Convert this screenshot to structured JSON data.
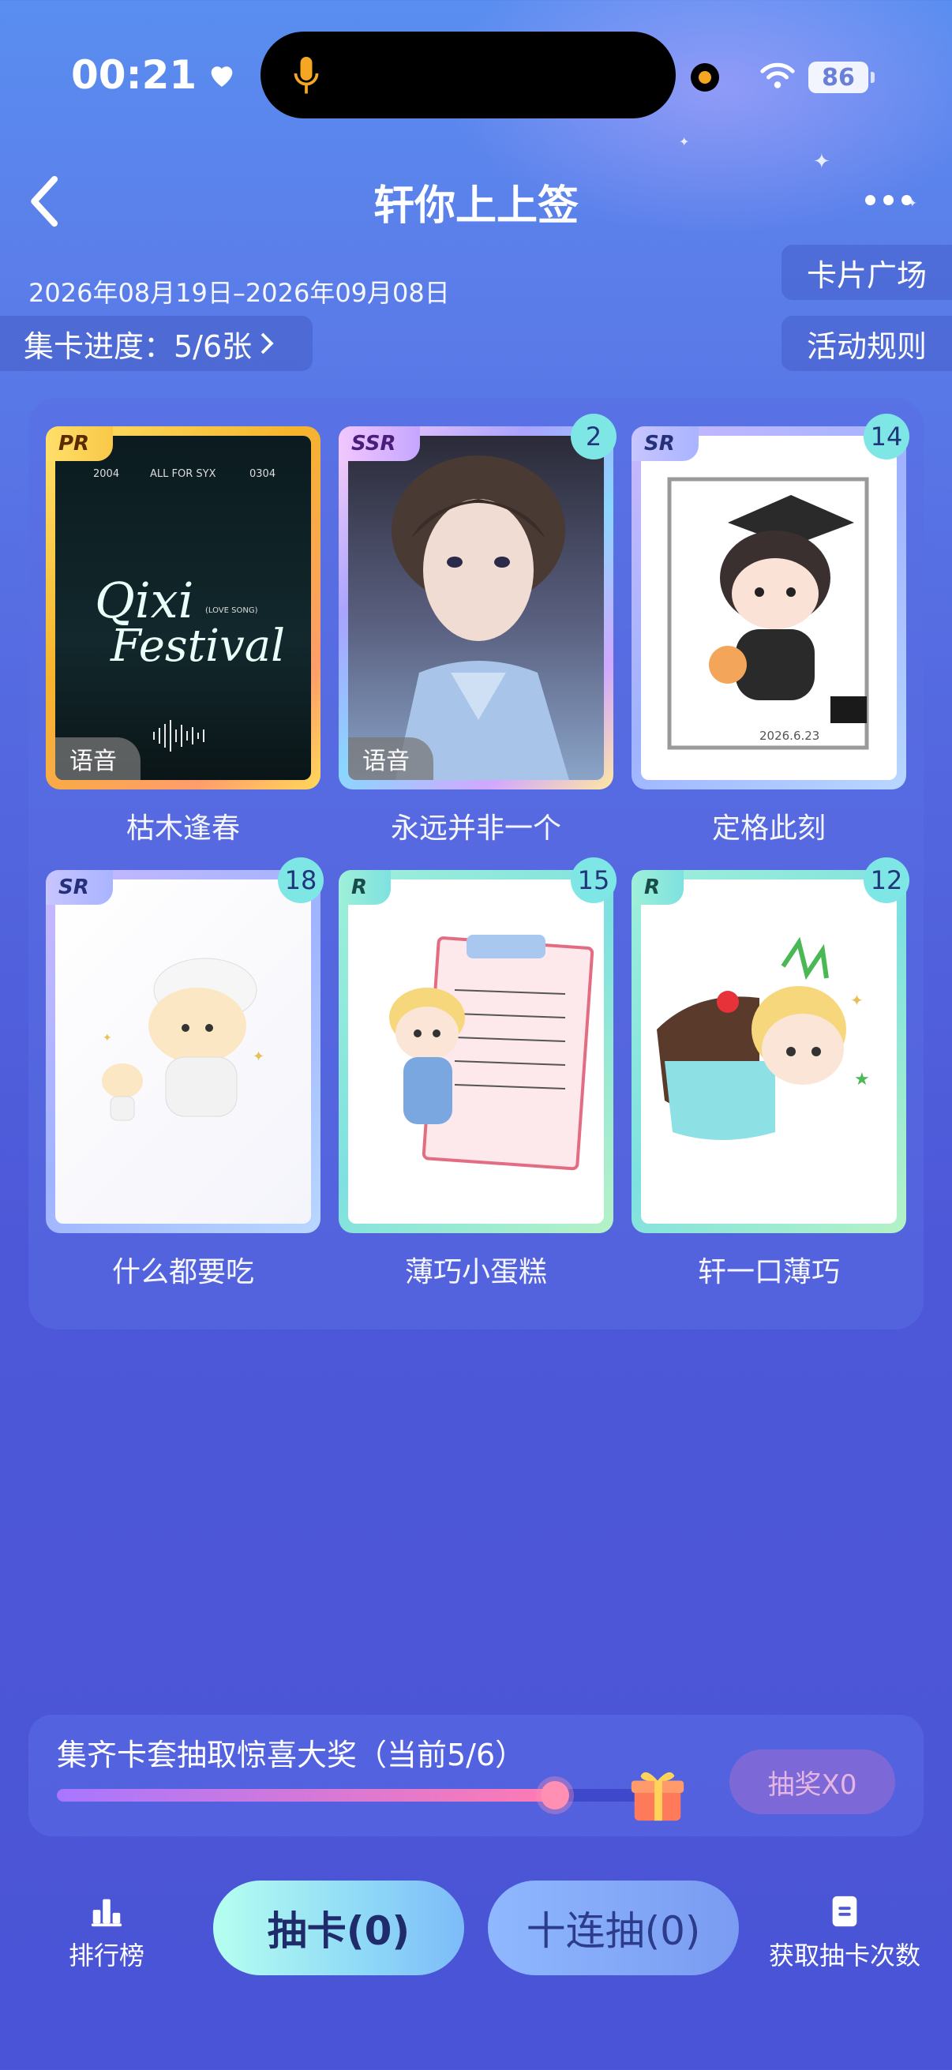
{
  "status_bar": {
    "time": "00:21",
    "battery": "86"
  },
  "header": {
    "title": "轩你上上签"
  },
  "event": {
    "date_range": "2026年08月19日–2026年09月08日",
    "progress_label": "集卡进度：5/6张",
    "card_plaza_label": "卡片广场",
    "rules_label": "活动规则"
  },
  "cards": [
    {
      "name": "枯木逢春",
      "rarity": "PR",
      "count": "",
      "voice": "语音",
      "art_text": [
        "2004",
        "ALL FOR SYX",
        "0304",
        "Qixi",
        "(LOVE SONG)",
        "Festival"
      ]
    },
    {
      "name": "永远并非一个",
      "rarity": "SSR",
      "count": "2",
      "voice": "语音"
    },
    {
      "name": "定格此刻",
      "rarity": "SR",
      "count": "14",
      "voice": "",
      "art_text": [
        "2026.6.23"
      ]
    },
    {
      "name": "什么都要吃",
      "rarity": "SR",
      "count": "18",
      "voice": ""
    },
    {
      "name": "薄巧小蛋糕",
      "rarity": "R",
      "count": "15",
      "voice": ""
    },
    {
      "name": "轩一口薄巧",
      "rarity": "R",
      "count": "12",
      "voice": ""
    }
  ],
  "prize": {
    "text": "集齐卡套抽取惊喜大奖（当前5/6）",
    "progress": 0.83,
    "draw_label": "抽奖X0"
  },
  "bottom_bar": {
    "ranking_label": "排行榜",
    "draw_one_label": "抽卡(0)",
    "draw_ten_label": "十连抽(0)",
    "get_chances_label": "获取抽卡次数"
  }
}
